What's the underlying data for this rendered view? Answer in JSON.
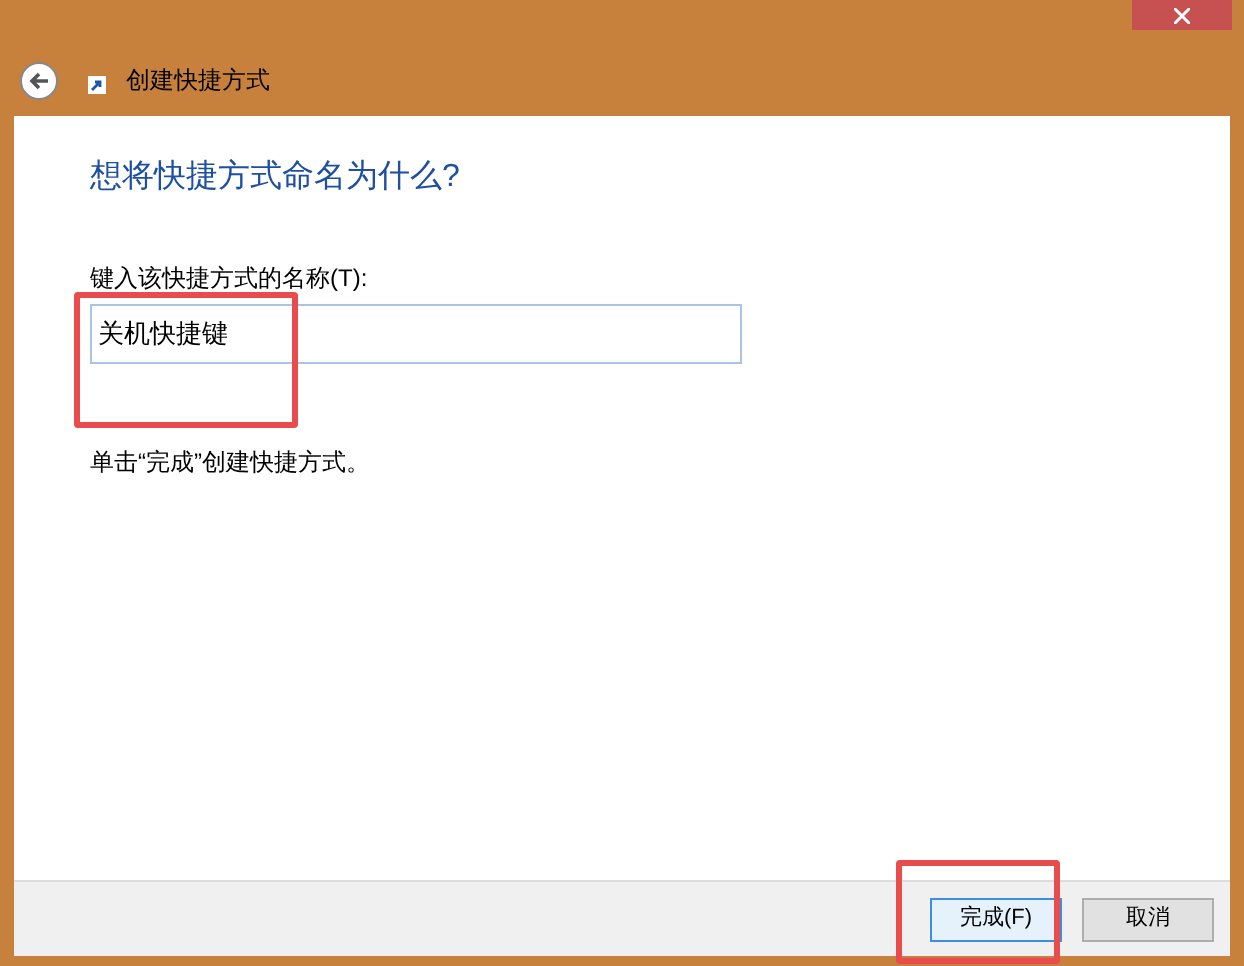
{
  "window": {
    "title": "创建快捷方式"
  },
  "heading": "想将快捷方式命名为什么?",
  "name_field": {
    "label": "键入该快捷方式的名称(T):",
    "value": "关机快捷键"
  },
  "hint": "单击“完成”创建快捷方式。",
  "buttons": [
    {
      "label": "完成(F)",
      "selected": true
    },
    {
      "label": "取消",
      "selected": false
    }
  ]
}
